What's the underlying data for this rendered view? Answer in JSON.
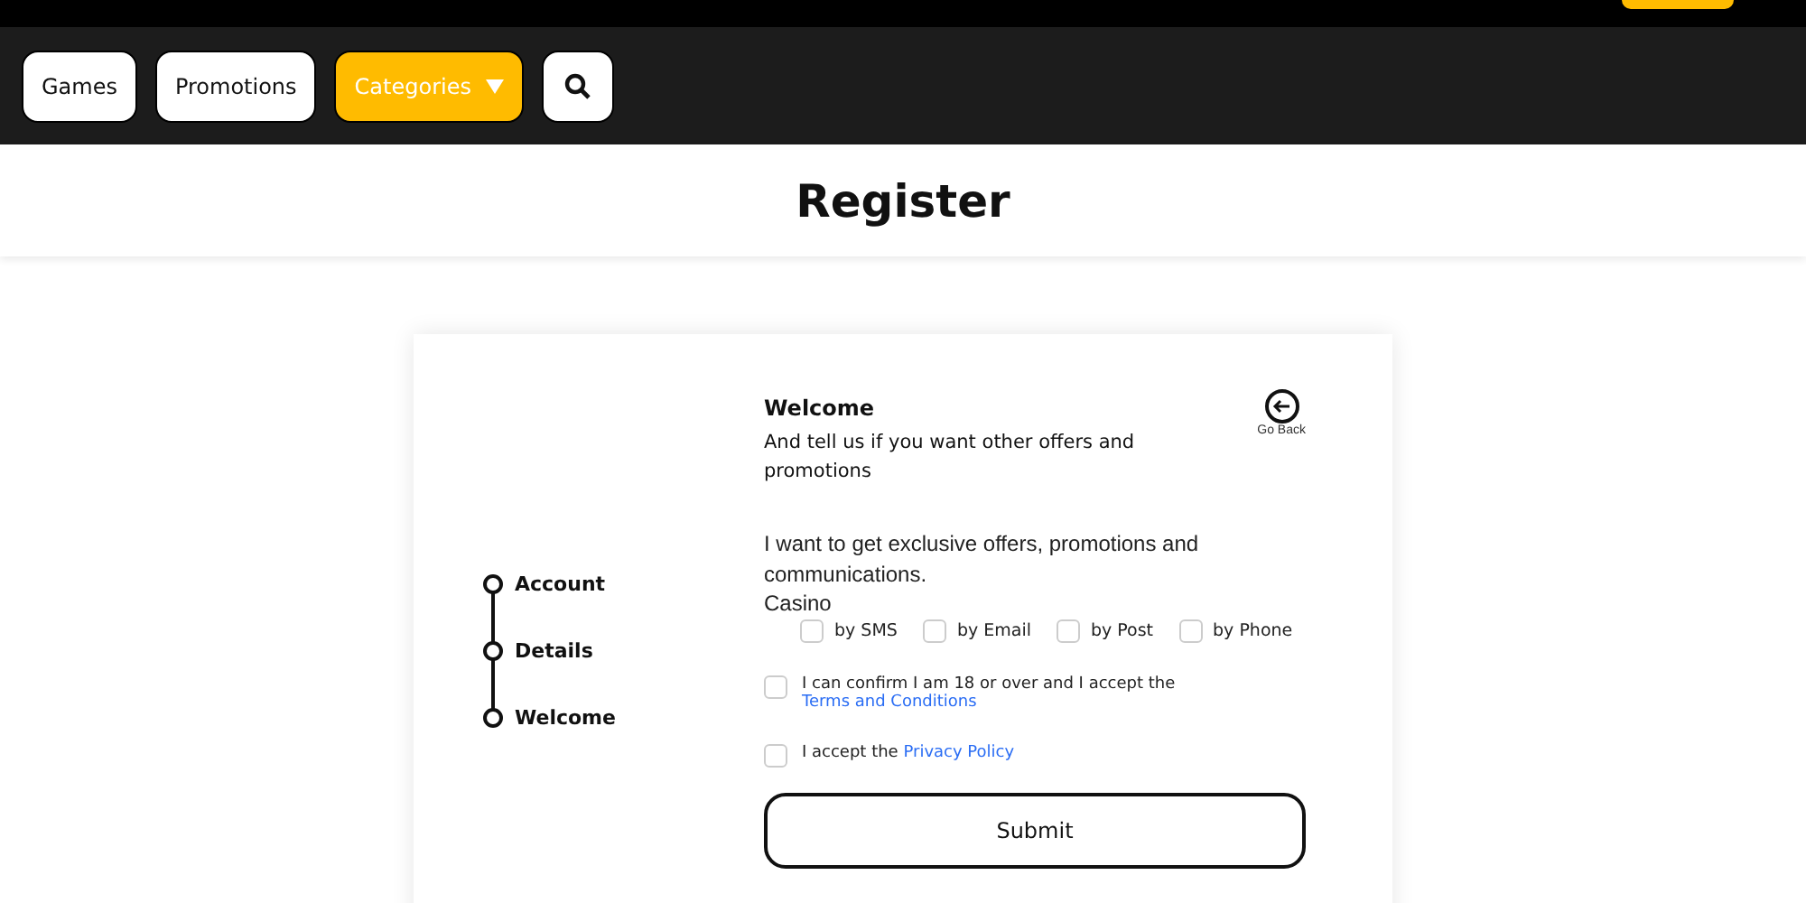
{
  "nav": [
    {
      "label": "Games",
      "kind": "plain"
    },
    {
      "label": "Promotions",
      "kind": "plain"
    },
    {
      "label": "Categories",
      "kind": "dropdown"
    },
    {
      "kind": "search"
    }
  ],
  "page_title": "Register",
  "steps": [
    {
      "label": "Account"
    },
    {
      "label": "Details"
    },
    {
      "label": "Welcome"
    }
  ],
  "form": {
    "title": "Welcome",
    "subtitle": "And tell us if you want other offers and promotions",
    "go_back": "Go Back",
    "offers_text": "I want to get exclusive offers, promotions and communications.",
    "group": "Casino",
    "channels": [
      {
        "label": "by SMS",
        "checked": false
      },
      {
        "label": "by Email",
        "checked": false
      },
      {
        "label": "by Post",
        "checked": false
      },
      {
        "label": "by Phone",
        "checked": false
      }
    ],
    "consents": [
      {
        "text": "I can confirm I am 18 or over and I accept the",
        "link": "Terms and Conditions",
        "checked": false
      },
      {
        "text": "I accept the",
        "link": "Privacy Policy",
        "checked": false
      }
    ],
    "submit": "Submit"
  }
}
